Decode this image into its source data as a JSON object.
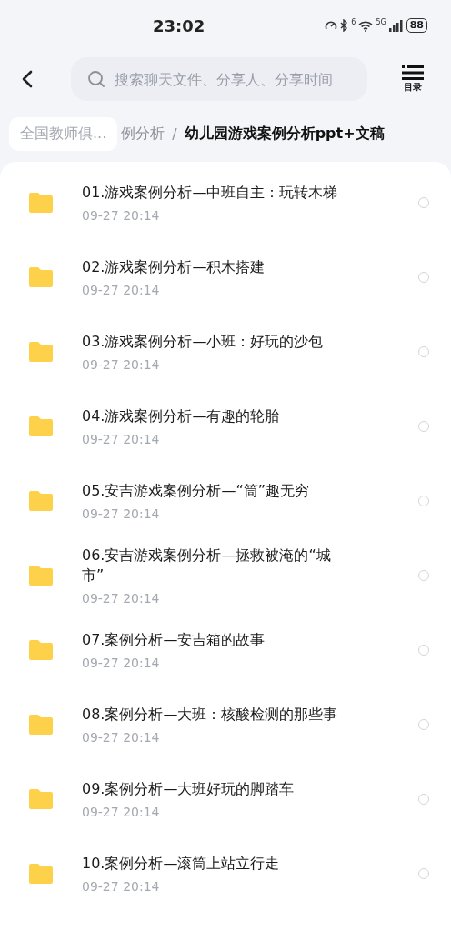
{
  "status_bar": {
    "time": "23:02",
    "wifi_badge": "6",
    "network": "5G",
    "battery": "88"
  },
  "header": {
    "search": {
      "placeholder": "搜索聊天文件、分享人、分享时间"
    },
    "toc_label": "目录"
  },
  "breadcrumb": [
    {
      "label": "全国教师俱...",
      "kind": "root"
    },
    {
      "label": "例分析",
      "kind": "middle",
      "separator": "/"
    },
    {
      "label": "幼儿园游戏案例分析ppt+文稿",
      "kind": "current"
    }
  ],
  "files": [
    {
      "title": "01.游戏案例分析—中班自主：玩转木梯",
      "date": "09-27  20:14",
      "selected": false
    },
    {
      "title": "02.游戏案例分析—积木搭建",
      "date": "09-27  20:14",
      "selected": false
    },
    {
      "title": "03.游戏案例分析—小班：好玩的沙包",
      "date": "09-27  20:14",
      "selected": false
    },
    {
      "title": "04.游戏案例分析—有趣的轮胎",
      "date": "09-27  20:14",
      "selected": false
    },
    {
      "title": "05.安吉游戏案例分析—“筒”趣无穷",
      "date": "09-27  20:14",
      "selected": false
    },
    {
      "title": "06.安吉游戏案例分析—拯救被淹的“城市”",
      "date": "09-27  20:14",
      "selected": false
    },
    {
      "title": "07.案例分析—安吉箱的故事",
      "date": "09-27  20:14",
      "selected": false
    },
    {
      "title": "08.案例分析—大班：核酸检测的那些事",
      "date": "09-27  20:14",
      "selected": false
    },
    {
      "title": "09.案例分析—大班好玩的脚踏车",
      "date": "09-27  20:14",
      "selected": false
    },
    {
      "title": "10.案例分析—滚筒上站立行走",
      "date": "09-27  20:14",
      "selected": false
    }
  ]
}
